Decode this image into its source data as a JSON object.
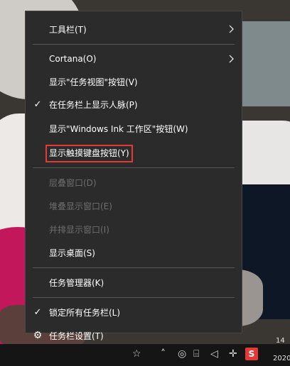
{
  "menu": {
    "items": [
      {
        "label": "工具栏(T)",
        "submenu": true,
        "checked": false,
        "enabled": true
      },
      {
        "label": "Cortana(O)",
        "submenu": true,
        "checked": false,
        "enabled": true
      },
      {
        "label": "显示\"任务视图\"按钮(V)",
        "submenu": false,
        "checked": false,
        "enabled": true
      },
      {
        "label": "在任务栏上显示人脉(P)",
        "submenu": false,
        "checked": true,
        "enabled": true
      },
      {
        "label": "显示\"Windows Ink 工作区\"按钮(W)",
        "submenu": false,
        "checked": false,
        "enabled": true
      },
      {
        "label": "显示触摸键盘按钮(Y)",
        "submenu": false,
        "checked": false,
        "enabled": true,
        "highlighted": true
      },
      {
        "label": "层叠窗口(D)",
        "submenu": false,
        "checked": false,
        "enabled": false
      },
      {
        "label": "堆叠显示窗口(E)",
        "submenu": false,
        "checked": false,
        "enabled": false
      },
      {
        "label": "并排显示窗口(I)",
        "submenu": false,
        "checked": false,
        "enabled": false
      },
      {
        "label": "显示桌面(S)",
        "submenu": false,
        "checked": false,
        "enabled": true
      },
      {
        "label": "任务管理器(K)",
        "submenu": false,
        "checked": false,
        "enabled": true
      },
      {
        "label": "锁定所有任务栏(L)",
        "submenu": false,
        "checked": true,
        "enabled": true
      },
      {
        "label": "任务栏设置(T)",
        "submenu": false,
        "checked": false,
        "enabled": true,
        "icon": "gear-icon"
      }
    ]
  },
  "taskbar": {
    "ime_label": "S",
    "clock_time": "14",
    "clock_date": "2020"
  },
  "colors": {
    "menu_bg": "#2b2b2b",
    "highlight_border": "#e53935",
    "disabled_text": "#6e6e6e"
  }
}
